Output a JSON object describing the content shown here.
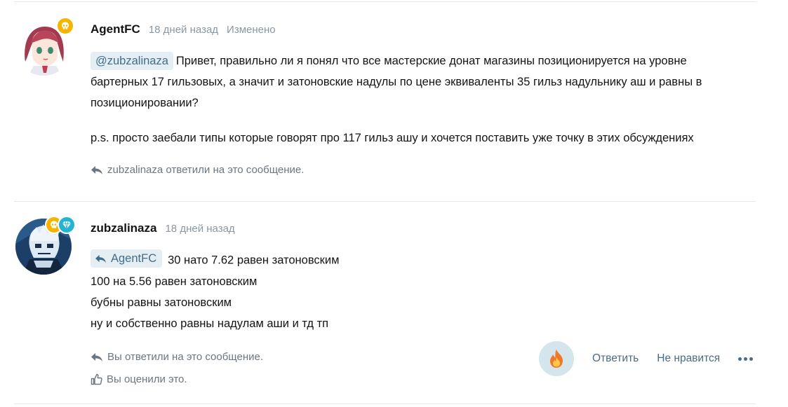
{
  "post1": {
    "author": "AgentFC",
    "time": "18 дней назад",
    "edited": "Изменено",
    "mention": "@zubzalinaza",
    "text_line1": "Привет, правильно ли я понял что все мастерские донат магазины позиционируется на уровне",
    "text_rest": "бартерных 17 гильзовых, а значит и затоновские надулы по цене эквиваленты 35 гильз надульнику аш и равны в позиционировании?",
    "ps": "p.s. просто заебали типы которые говорят про 117 гильз ашу и хочется поставить уже точку в этих обсуждениях",
    "reply_note": "zubzalinaza ответили на это сообщение.",
    "badge_icon": "skull-icon"
  },
  "post2": {
    "author": "zubzalinaza",
    "time": "18 дней назад",
    "quote_author": "AgentFC",
    "line1": "30 нато 7.62 равен затоновским",
    "line2": "100 на 5.56 равен затоновским",
    "line3": "бубны равны затоновским",
    "line4": "ну и собственно равны надулам аши и тд тп",
    "reply_note": "Вы ответили на это сообщение.",
    "like_note": "Вы оценили это.",
    "reaction_icon": "fire-icon",
    "reply_label": "Ответить",
    "dislike_label": "Не нравится",
    "more_icon": "more-icon"
  }
}
